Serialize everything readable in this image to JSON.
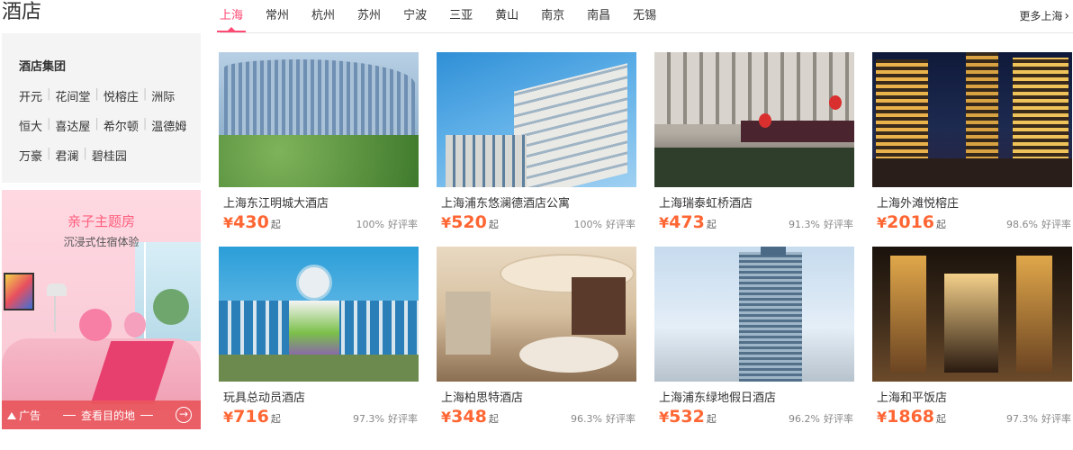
{
  "header": {
    "title": "酒店",
    "tabs": [
      "上海",
      "常州",
      "杭州",
      "苏州",
      "宁波",
      "三亚",
      "黄山",
      "南京",
      "南昌",
      "无锡"
    ],
    "active_tab": "上海",
    "more_label": "更多上海",
    "more_icon": "chevron-right-icon"
  },
  "sidebar": {
    "group_title": "酒店集团",
    "brand_rows": [
      [
        "开元",
        "花间堂",
        "悦榕庄",
        "洲际"
      ],
      [
        "恒大",
        "喜达屋",
        "希尔顿",
        "温德姆"
      ],
      [
        "万豪",
        "君澜",
        "碧桂园"
      ]
    ]
  },
  "ad": {
    "heading": "亲子主题房",
    "subheading": "沉浸式住宿体验",
    "tag": "广告",
    "cta": "查看目的地"
  },
  "currency_symbol": "¥",
  "price_unit": "起",
  "rating_label": "好评率",
  "hotels": [
    {
      "name": "上海东江明城大酒店",
      "price": "430",
      "rating": "100%"
    },
    {
      "name": "上海浦东悠澜德酒店公寓",
      "price": "520",
      "rating": "100%"
    },
    {
      "name": "上海瑞泰虹桥酒店",
      "price": "473",
      "rating": "91.3%"
    },
    {
      "name": "上海外滩悦榕庄",
      "price": "2016",
      "rating": "98.6%"
    },
    {
      "name": "玩具总动员酒店",
      "price": "716",
      "rating": "97.3%"
    },
    {
      "name": "上海柏思特酒店",
      "price": "348",
      "rating": "96.3%"
    },
    {
      "name": "上海浦东绿地假日酒店",
      "price": "532",
      "rating": "96.2%"
    },
    {
      "name": "上海和平饭店",
      "price": "1868",
      "rating": "97.3%"
    }
  ],
  "colors": {
    "accent": "#ff4a73",
    "price": "#ff6633",
    "ad_bar": "#e8565c"
  }
}
